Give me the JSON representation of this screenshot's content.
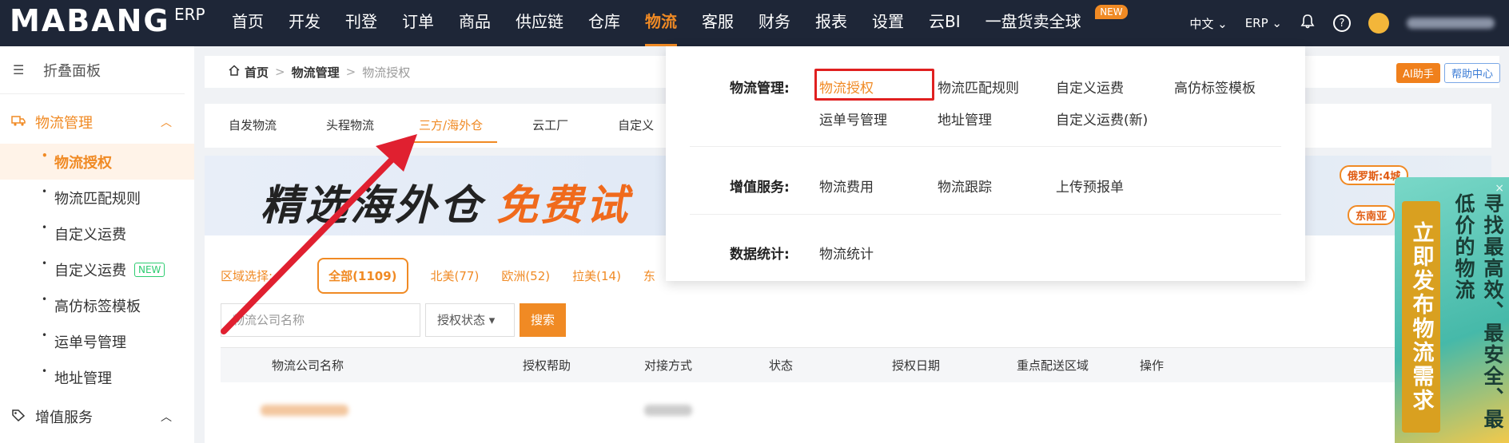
{
  "brand": {
    "logo": "MABANG",
    "sub": "ERP"
  },
  "nav": {
    "items": [
      "首页",
      "开发",
      "刊登",
      "订单",
      "商品",
      "供应链",
      "仓库",
      "物流",
      "客服",
      "财务",
      "报表",
      "设置",
      "云BI",
      "一盘货卖全球"
    ],
    "active": "物流",
    "new_badge": "NEW"
  },
  "top_right": {
    "lang": "中文 ⌄",
    "erp": "ERP ⌄",
    "help_icon": "?"
  },
  "sidebar": {
    "fold": "折叠面板",
    "group1": "物流管理",
    "items": [
      "物流授权",
      "物流匹配规则",
      "自定义运费",
      "自定义运费",
      "高仿标签模板",
      "运单号管理",
      "地址管理"
    ],
    "new_badge": "NEW",
    "group2": "增值服务"
  },
  "breadcrumb": {
    "home": "首页",
    "mid": "物流管理",
    "current": "物流授权"
  },
  "tabs": [
    "自发物流",
    "头程物流",
    "三方/海外仓",
    "云工厂",
    "自定义"
  ],
  "banner": {
    "t1": "精选海外仓",
    "t2": "免费试",
    "tag1": "俄罗斯:4城",
    "tag2": "东南亚"
  },
  "region": {
    "label": "区域选择:",
    "options": [
      "全部(1109)",
      "北美(77)",
      "欧洲(52)",
      "拉美(14)",
      "东"
    ]
  },
  "search": {
    "placeholder": "物流公司名称",
    "status": "授权状态 ▾",
    "button": "搜索"
  },
  "table": {
    "headers": [
      "物流公司名称",
      "授权帮助",
      "对接方式",
      "状态",
      "授权日期",
      "重点配送区域",
      "操作"
    ]
  },
  "float": {
    "ai": "AI助手",
    "help": "帮助中心"
  },
  "ad": {
    "strip": "立即发布物流需求",
    "text": "寻找最高效、最安全、最低价的物流",
    "close": "×"
  },
  "dropdown": {
    "sections": [
      {
        "label": "物流管理:",
        "links": [
          "物流授权",
          "物流匹配规则",
          "自定义运费",
          "高仿标签模板",
          "运单号管理",
          "地址管理",
          "自定义运费(新)"
        ]
      },
      {
        "label": "增值服务:",
        "links": [
          "物流费用",
          "物流跟踪",
          "上传预报单"
        ]
      },
      {
        "label": "数据统计:",
        "links": [
          "物流统计"
        ]
      }
    ]
  },
  "colors": {
    "accent": "#f08a24",
    "topbar": "#1e2637",
    "annotation": "#e02020"
  }
}
